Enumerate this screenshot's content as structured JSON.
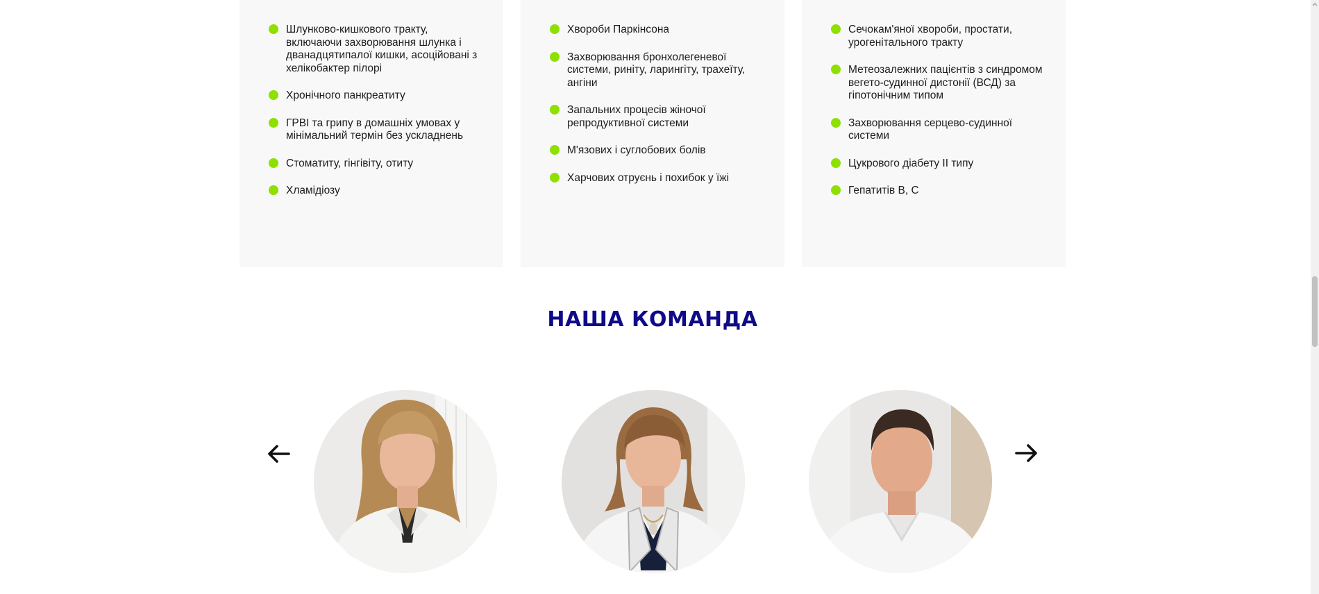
{
  "indications": {
    "column_1": [
      "Шлунково-кишкового тракту, включаючи захворювання шлунка і дванадцятипалої кишки, асоційовані з хелікобактер пілорі",
      "Хронічного панкреатиту",
      "ГРВІ та грипу в домашніх умовах у мінімальний термін без ускладнень",
      "Стоматиту, гінгівіту, отиту",
      "Хламідіозу"
    ],
    "column_2": [
      "Хвороби Паркінсона",
      "Захворювання бронхолегеневої системи, риніту, ларингіту, трахеїту, ангіни",
      "Запальних процесів жіночої репродуктивної системи",
      "М'язових і суглобових болів",
      "Харчових отруєнь і похибок у їжі"
    ],
    "column_3": [
      "Сечокам'яної хвороби, простати, урогенітального тракту",
      "Метеозалежних пацієнтів з синдромом вегето-судинної дистонії (ВСД) за гіпотонічним типом",
      "Захворювання серцево-судинної системи",
      "Цукрового діабету ІІ типу",
      "Гепатитів В, С"
    ]
  },
  "team": {
    "title": "НАША КОМАНДА",
    "prev_icon": "arrow-left-icon",
    "next_icon": "arrow-right-icon"
  },
  "colors": {
    "accent": "#8ee000",
    "title": "#0f0a88",
    "card_bg": "#f8f8f8",
    "text": "#1d1d1d"
  }
}
